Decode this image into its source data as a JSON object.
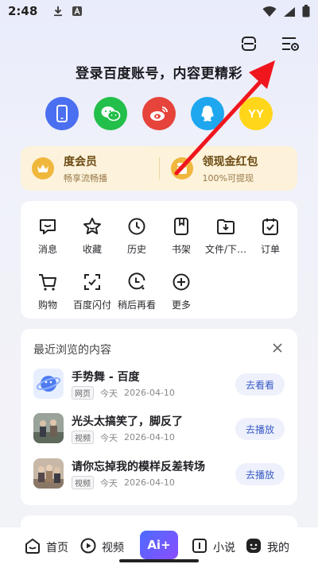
{
  "status": {
    "time": "2:48"
  },
  "login": {
    "title": "登录百度账号，内容更精彩",
    "providers": [
      {
        "name": "phone-icon",
        "color": "#4a6ff0"
      },
      {
        "name": "wechat-icon",
        "color": "#22bf4a"
      },
      {
        "name": "weibo-icon",
        "color": "#e6433b"
      },
      {
        "name": "qq-icon",
        "color": "#1ea7ee"
      },
      {
        "name": "yy-icon",
        "color": "#ffd61a",
        "label": "YY"
      }
    ]
  },
  "vip": {
    "member_title": "度会员",
    "member_sub": "畅享流畅播",
    "redpack_title": "领现金红包",
    "redpack_sub": "100%可提现"
  },
  "functions": [
    {
      "label": "消息",
      "icon": "message-icon"
    },
    {
      "label": "收藏",
      "icon": "star-icon"
    },
    {
      "label": "历史",
      "icon": "clock-icon"
    },
    {
      "label": "书架",
      "icon": "bookmark-icon"
    },
    {
      "label": "文件/下…",
      "icon": "folder-download-icon"
    },
    {
      "label": "订单",
      "icon": "order-icon"
    },
    {
      "label": "购物",
      "icon": "cart-icon"
    },
    {
      "label": "百度闪付",
      "icon": "scan-pay-icon"
    },
    {
      "label": "稍后再看",
      "icon": "later-icon"
    },
    {
      "label": "更多",
      "icon": "plus-icon"
    }
  ],
  "recent": {
    "title": "最近浏览的内容",
    "items": [
      {
        "title": "手势舞 - 百度",
        "tag": "网页",
        "day": "今天",
        "date": "2026-04-10",
        "action": "去看看"
      },
      {
        "title": "光头太搞笑了，脚反了",
        "tag": "视频",
        "day": "今天",
        "date": "2026-04-10",
        "action": "去播放"
      },
      {
        "title": "请你忘掉我的模样反差转场",
        "tag": "视频",
        "day": "今天",
        "date": "2026-04-10",
        "action": "去播放"
      }
    ]
  },
  "nav": {
    "home": "首页",
    "video": "视频",
    "ai": "Ai+",
    "novel": "小说",
    "mine": "我的"
  },
  "colors": {
    "accent": "#3a5bc7",
    "arrow": "#f0161e"
  }
}
